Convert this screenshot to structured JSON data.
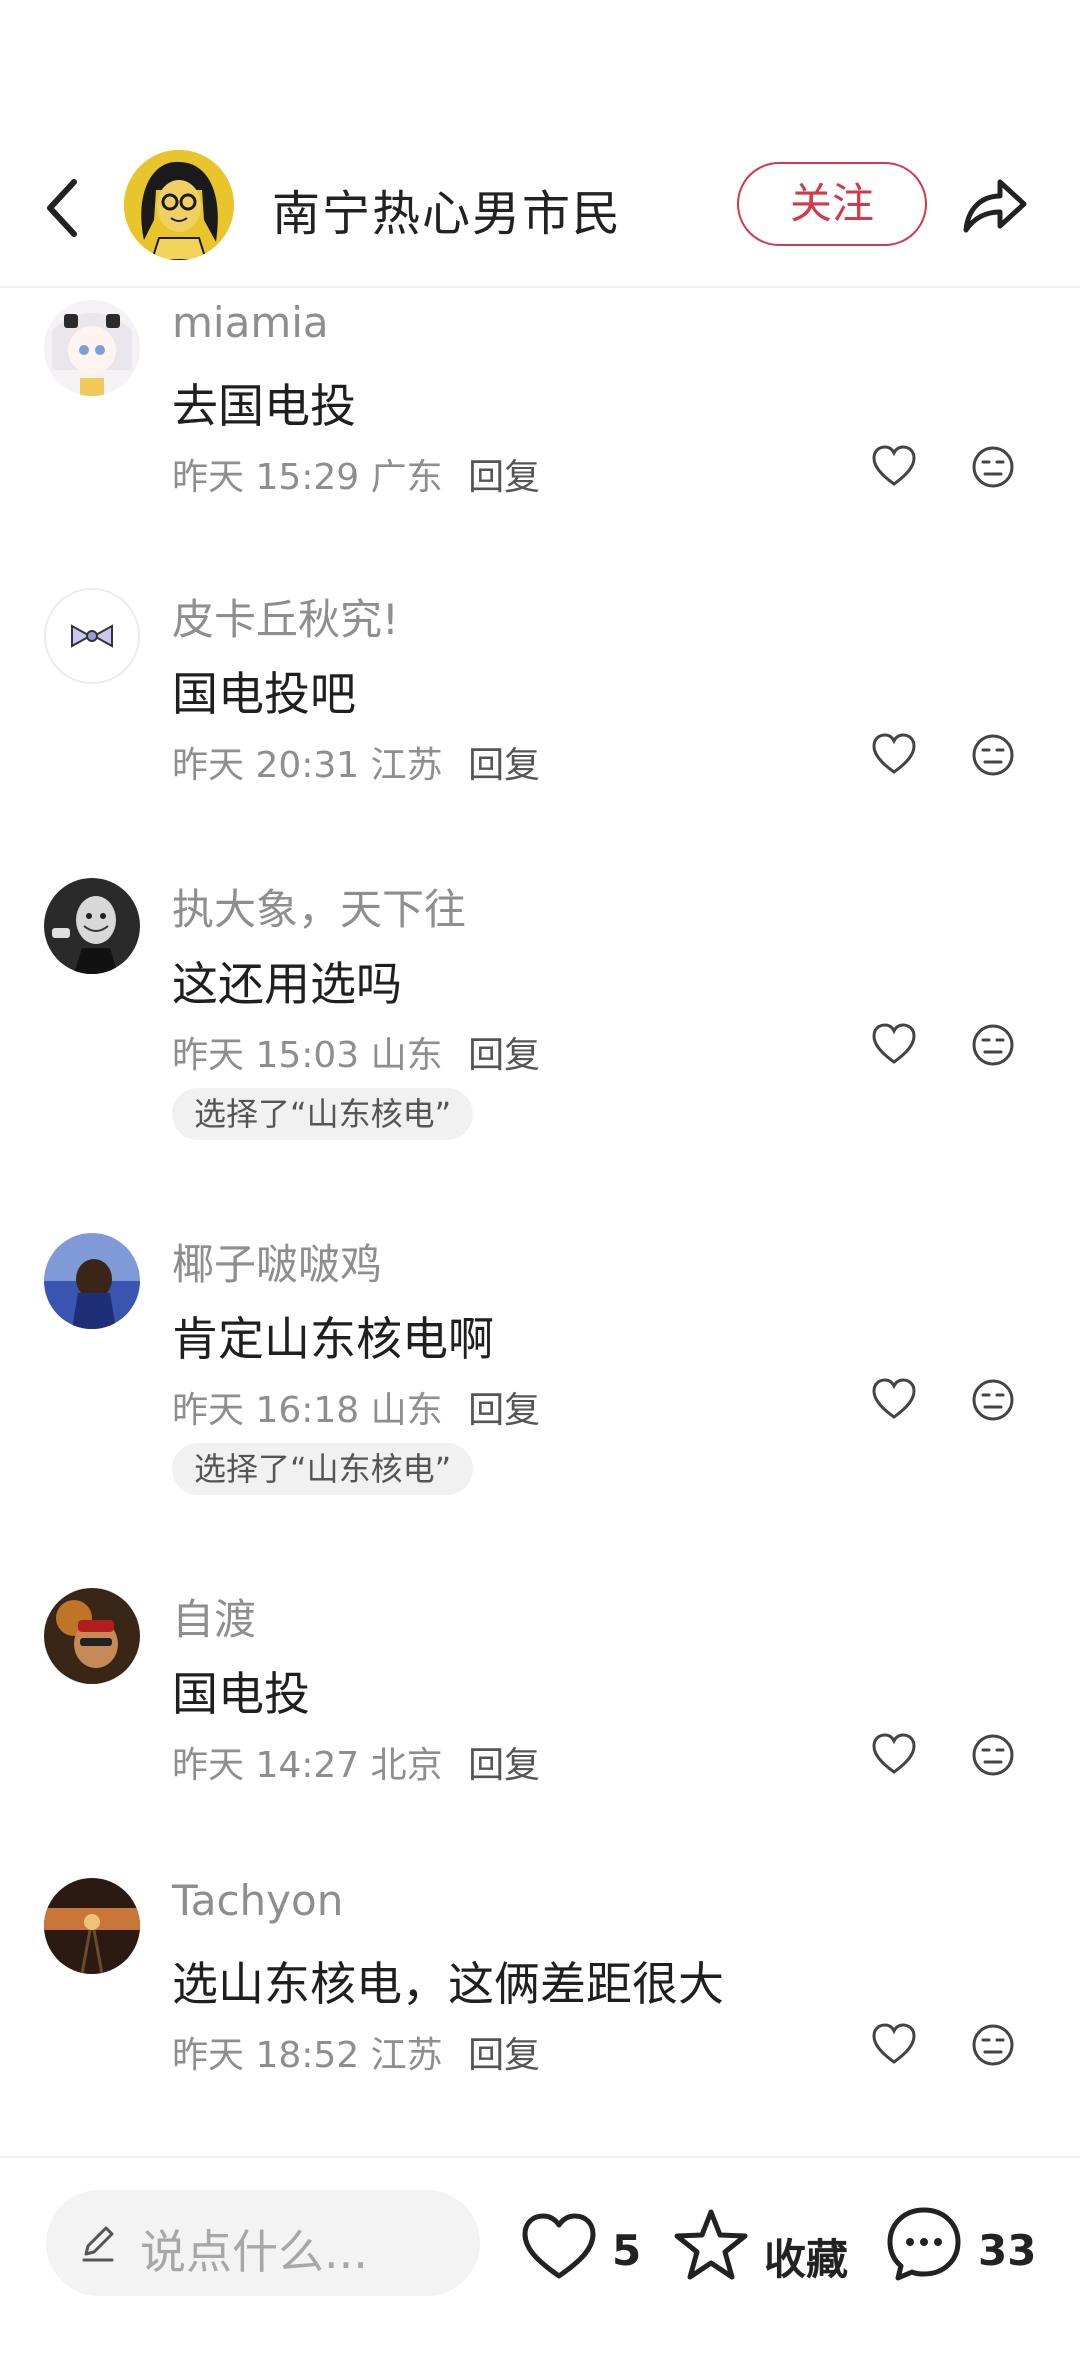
{
  "header": {
    "title": "南宁热心男市民",
    "follow_label": "关注"
  },
  "comments": [
    {
      "username": "miamia",
      "content": "去国电投",
      "time": "昨天 15:29",
      "location": "广东",
      "reply": "回复",
      "choice": ""
    },
    {
      "username": "皮卡丘秋究!",
      "content": "国电投吧",
      "time": "昨天 20:31",
      "location": "江苏",
      "reply": "回复",
      "choice": ""
    },
    {
      "username": "执大象，天下往",
      "content": "这还用选吗",
      "time": "昨天 15:03",
      "location": "山东",
      "reply": "回复",
      "choice": "选择了“山东核电”"
    },
    {
      "username": "椰子啵啵鸡",
      "content": "肯定山东核电啊",
      "time": "昨天 16:18",
      "location": "山东",
      "reply": "回复",
      "choice": "选择了“山东核电”"
    },
    {
      "username": "自渡",
      "content": "国电投",
      "time": "昨天 14:27",
      "location": "北京",
      "reply": "回复",
      "choice": ""
    },
    {
      "username": "Tachyon",
      "content": "选山东核电，这俩差距很大",
      "time": "昨天 18:52",
      "location": "江苏",
      "reply": "回复",
      "choice": ""
    }
  ],
  "bottom_bar": {
    "input_placeholder": "说点什么...",
    "like_count": "5",
    "collect_label": "收藏",
    "comment_count": "33"
  },
  "colors": {
    "accent": "#d23a48",
    "meta": "#8e8e8e"
  }
}
